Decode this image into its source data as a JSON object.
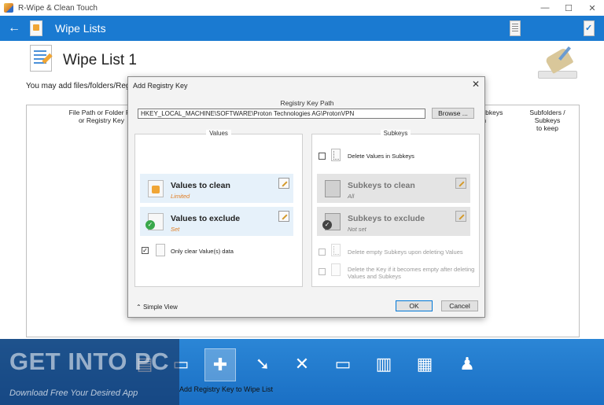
{
  "window": {
    "title": "R-Wipe & Clean Touch",
    "minimize": "—",
    "maximize": "☐",
    "close": "✕"
  },
  "header": {
    "back_icon": "←",
    "title": "Wipe Lists"
  },
  "page": {
    "title": "Wipe List 1",
    "hint": "You may add files/folders/Regist",
    "columns": {
      "file_path": "File Path or Folder Pa\nor Registry Key",
      "subkeys_clean": "/ Subkeys\nlean",
      "subfolders_keep": "Subfolders / Subkeys\nto keep"
    }
  },
  "dialog": {
    "title": "Add Registry Key",
    "close_icon": "✕",
    "path_label": "Registry Key Path",
    "path_value": "HKEY_LOCAL_MACHINE\\SOFTWARE\\Proton Technologies AG\\ProtonVPN",
    "browse": "Browse ...",
    "values_group": {
      "title": "Values",
      "clean": {
        "label": "Values to clean",
        "sub": "Limited"
      },
      "exclude": {
        "label": "Values to exclude",
        "sub": "Set"
      },
      "only_clear": {
        "label": "Only clear Value(s) data",
        "checked": "✓"
      }
    },
    "subkeys_group": {
      "title": "Subkeys",
      "delete_values": {
        "label": "Delete Values in Subkeys",
        "checked": ""
      },
      "clean": {
        "label": "Subkeys to clean",
        "sub": "All"
      },
      "exclude": {
        "label": "Subkeys to exclude",
        "sub": "Not set"
      },
      "delete_empty": {
        "label": "Delete empty Subkeys upon deleting Values"
      },
      "delete_key": {
        "label": "Delete the Key if it becomes empty after deleting\nValues and Subkeys"
      }
    },
    "simple_view": "Simple View",
    "simple_view_icon": "⌃",
    "ok": "OK",
    "cancel": "Cancel"
  },
  "toolbar": {
    "caption": "Add Registry Key to Wipe List",
    "icons": [
      "add-file-icon",
      "add-folder-icon",
      "add-registry-key-icon",
      "move-down-icon",
      "delete-icon",
      "rename-icon",
      "wipe-list-icon",
      "add-wipe-list-icon",
      "help-icon"
    ],
    "glyphs": [
      "▤",
      "▭",
      "✚",
      "➘",
      "✕",
      "▭",
      "▥",
      "▦",
      "♟"
    ]
  },
  "watermark": {
    "big": "GET INTO PC",
    "small": "Download Free Your Desired App"
  },
  "colors": {
    "accent": "#1a7ad1",
    "orange": "#e07b1f",
    "card_bg": "#e6f1fa"
  }
}
